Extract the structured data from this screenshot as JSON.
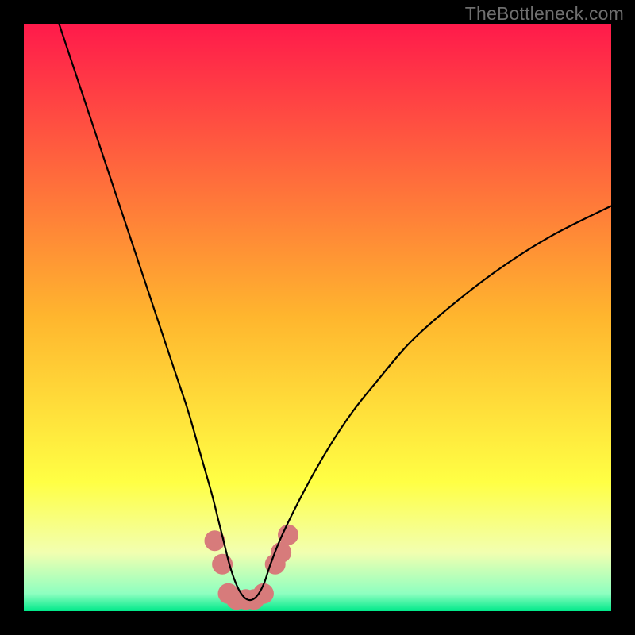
{
  "watermark": "TheBottleneck.com",
  "chart_data": {
    "type": "line",
    "title": "",
    "xlabel": "",
    "ylabel": "",
    "xlim": [
      0,
      100
    ],
    "ylim": [
      0,
      100
    ],
    "grid": false,
    "legend": false,
    "background_gradient": {
      "stops": [
        {
          "offset": 0.0,
          "color": "#ff1a4b"
        },
        {
          "offset": 0.5,
          "color": "#ffb62e"
        },
        {
          "offset": 0.78,
          "color": "#ffff44"
        },
        {
          "offset": 0.9,
          "color": "#f2ffb0"
        },
        {
          "offset": 0.97,
          "color": "#8effc0"
        },
        {
          "offset": 1.0,
          "color": "#00e98a"
        }
      ]
    },
    "series": [
      {
        "name": "bottleneck-curve",
        "color": "#000000",
        "x": [
          6,
          8,
          10,
          12,
          14,
          16,
          18,
          20,
          22,
          24,
          26,
          28,
          30,
          32,
          33,
          34,
          35,
          36,
          37,
          38,
          39,
          40,
          41,
          42,
          44,
          48,
          52,
          56,
          60,
          66,
          74,
          82,
          90,
          100
        ],
        "y": [
          100,
          94,
          88,
          82,
          76,
          70,
          64,
          58,
          52,
          46,
          40,
          34,
          27,
          20,
          16,
          12,
          8,
          5,
          3,
          2,
          2,
          3,
          5,
          8,
          13,
          21,
          28,
          34,
          39,
          46,
          53,
          59,
          64,
          69
        ]
      }
    ],
    "markers": {
      "name": "highlight-dots",
      "color": "#d77b7b",
      "radius": 13,
      "points": [
        {
          "x": 32.5,
          "y": 12
        },
        {
          "x": 33.8,
          "y": 8
        },
        {
          "x": 34.8,
          "y": 3
        },
        {
          "x": 36.2,
          "y": 2
        },
        {
          "x": 37.8,
          "y": 2
        },
        {
          "x": 39.2,
          "y": 2
        },
        {
          "x": 40.8,
          "y": 3
        },
        {
          "x": 42.8,
          "y": 8
        },
        {
          "x": 43.8,
          "y": 10
        },
        {
          "x": 45.0,
          "y": 13
        }
      ]
    }
  }
}
